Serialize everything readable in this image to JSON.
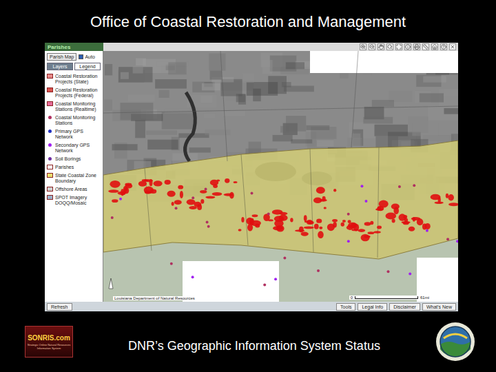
{
  "slide": {
    "title": "Office of Coastal Restoration and Management",
    "caption": "DNR’s Geographic Information System Status"
  },
  "screenshot": {
    "header": "Parishes",
    "map_select": "Parish Map",
    "auto": {
      "label": "Auto",
      "checked": true
    },
    "tabs": [
      {
        "label": "Layers",
        "selected": false
      },
      {
        "label": "Legend",
        "selected": true
      }
    ],
    "legend": [
      {
        "label": "Coastal Restoration Projects (State)",
        "kind": "area",
        "color": "#e88a8a"
      },
      {
        "label": "Coastal Restoration Projects (Federal)",
        "kind": "area",
        "color": "#d9534f"
      },
      {
        "label": "Coastal Monitoring Stations (Realtime)",
        "kind": "area",
        "color": "#e56b9a"
      },
      {
        "label": "Coastal Monitoring Stations",
        "kind": "point",
        "color": "#b03060"
      },
      {
        "label": "Primary GPS Network",
        "kind": "point",
        "color": "#2030c0"
      },
      {
        "label": "Secondary GPS Network",
        "kind": "point",
        "color": "#a020f0"
      },
      {
        "label": "Soil Borings",
        "kind": "point",
        "color": "#7030a0"
      },
      {
        "label": "Parishes",
        "kind": "area",
        "color": "#ffffff"
      },
      {
        "label": "State Coastal Zone Boundary",
        "kind": "area",
        "color": "#e8e070"
      },
      {
        "label": "Offshore Areas",
        "kind": "area",
        "color": "#d0d0d0"
      },
      {
        "label": "SPOT Imagery DOQQ/Mosaic",
        "kind": "area",
        "color": "#9ab0c8"
      }
    ],
    "map": {
      "credit": "Louisiana Department of Natural Resources",
      "scale_start": "0",
      "scale_end": "61mi"
    },
    "footer_left": "Refresh",
    "footer_buttons": [
      "Tools",
      "Legal Info",
      "Disclaimer",
      "What's New"
    ]
  },
  "logo": {
    "name": "SONRIS.com",
    "subtitle": "Strategic Online Natural Resources Information System"
  }
}
